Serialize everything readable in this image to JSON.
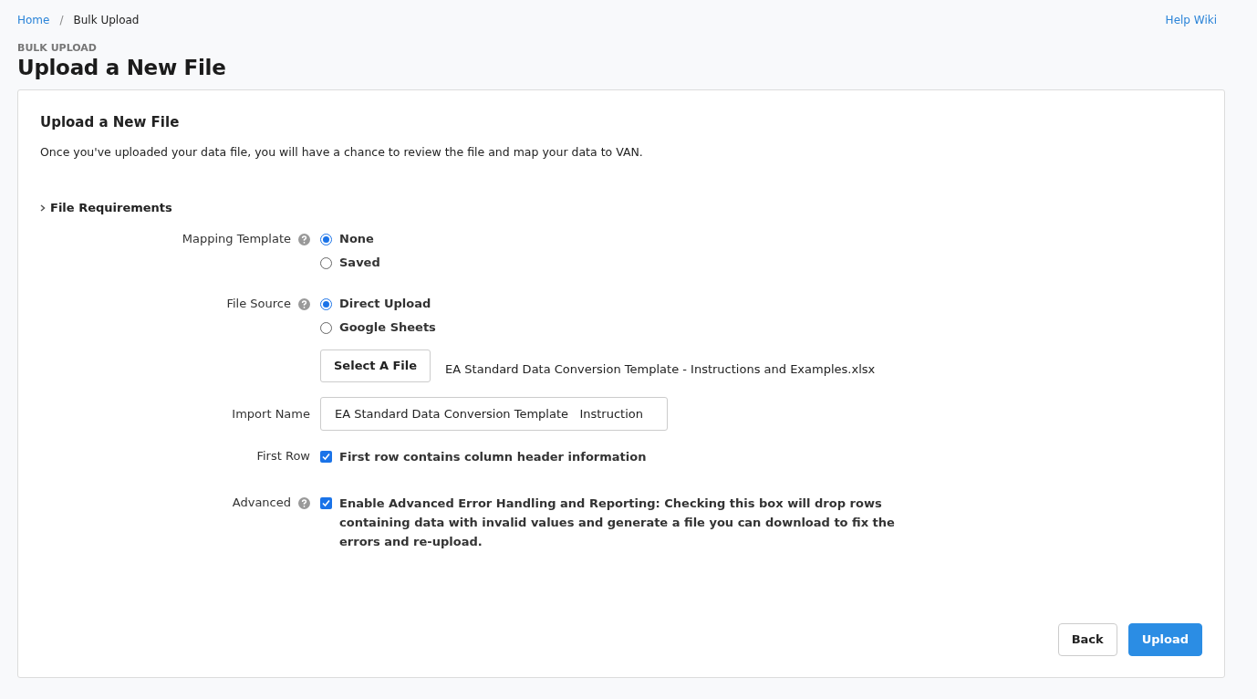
{
  "breadcrumb": [
    {
      "label": "Home",
      "kind": "link"
    },
    {
      "label": "Bulk Upload",
      "kind": "current"
    }
  ],
  "breadcrumb_separator": "/",
  "help_link": "Help Wiki",
  "page": {
    "eyebrow": "BULK UPLOAD",
    "title": "Upload a New File"
  },
  "card": {
    "title": "Upload a New File",
    "description": "Once you've uploaded your data file, you will have a chance to review the file and map your data to VAN.",
    "file_requirements": {
      "label": "File Requirements",
      "expanded": false
    },
    "fields": [
      {
        "kind": "radio",
        "label": "Mapping Template",
        "help": true,
        "options": [
          {
            "label": "None",
            "selected": true
          },
          {
            "label": "Saved",
            "selected": false
          }
        ]
      },
      {
        "kind": "radio",
        "label": "File Source",
        "help": true,
        "options": [
          {
            "label": "Direct Upload",
            "selected": true
          },
          {
            "label": "Google Sheets",
            "selected": false
          }
        ]
      },
      {
        "kind": "file",
        "button": "Select A File",
        "file_name": "EA Standard Data Conversion Template - Instructions and Examples.xlsx"
      },
      {
        "kind": "text",
        "label": "Import Name",
        "help": false,
        "value": "EA Standard Data Conversion Template   Instruction"
      },
      {
        "kind": "checkbox",
        "label": "First Row",
        "help": false,
        "checked": true,
        "text": "First row contains column header information"
      },
      {
        "kind": "checkbox",
        "label": "Advanced",
        "help": true,
        "checked": true,
        "text": "**Enable Advanced Error Handling and Reporting:** Checking this box will drop rows containing data with invalid values and generate a file you can download to fix the errors and re-upload."
      }
    ],
    "buttons": [
      {
        "label": "Back",
        "kind": "secondary"
      },
      {
        "label": "Upload",
        "kind": "primary"
      }
    ]
  }
}
